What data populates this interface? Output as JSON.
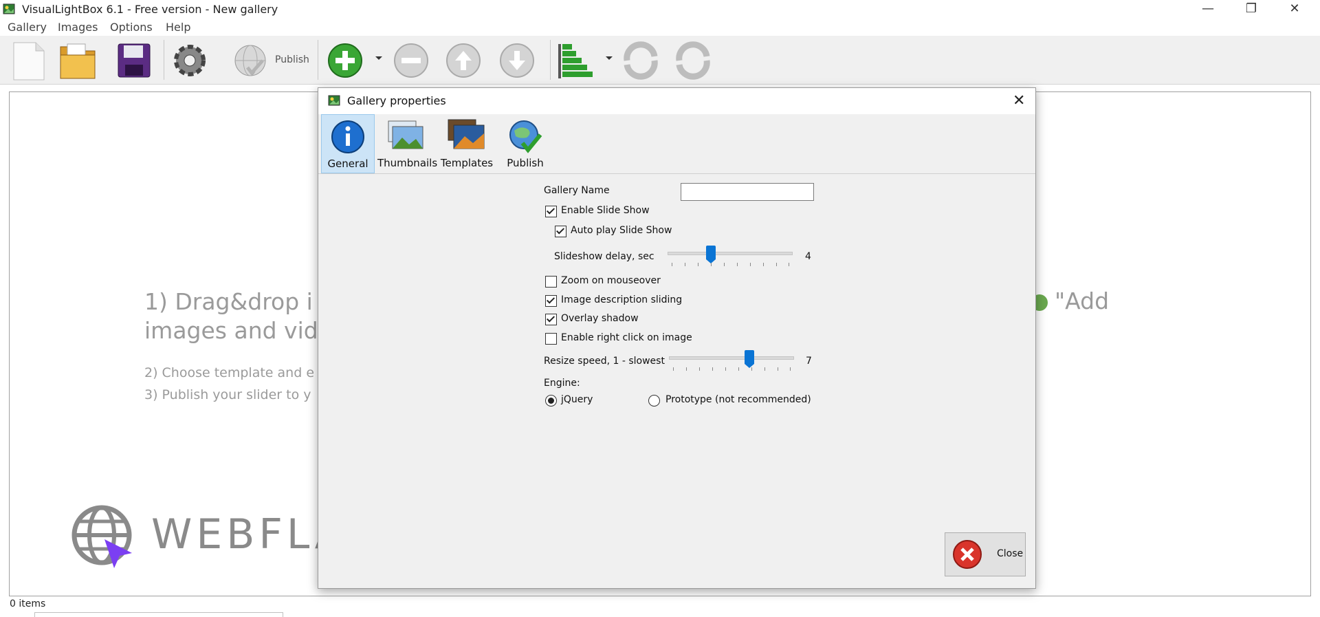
{
  "window": {
    "title": "VisualLightBox 6.1 - Free version -  New gallery",
    "controls": [
      "minimize-icon",
      "restore-icon",
      "close-icon"
    ]
  },
  "menu": {
    "items": [
      "Gallery",
      "Images",
      "Options",
      "Help"
    ]
  },
  "toolbar": {
    "publish_label": "Publish"
  },
  "canvas": {
    "instruction1_line1": "1) Drag&drop i",
    "instruction1_line2": "images and vid",
    "instruction1_tail": "\"Add",
    "instruction2": "2) Choose template and e",
    "instruction3": "3) Publish your slider to y"
  },
  "watermark": {
    "text": "WEBFLAT.ir"
  },
  "status": {
    "items": "0 items"
  },
  "dialog": {
    "title": "Gallery properties",
    "tabs": [
      {
        "label": "General",
        "icon": "info-icon",
        "active": true
      },
      {
        "label": "Thumbnails",
        "icon": "thumbnails-icon",
        "active": false
      },
      {
        "label": "Templates",
        "icon": "templates-icon",
        "active": false
      },
      {
        "label": "Publish",
        "icon": "globe-check-icon",
        "active": false
      }
    ],
    "general": {
      "gallery_name_label": "Gallery Name",
      "gallery_name_value": "",
      "enable_slideshow_label": "Enable Slide Show",
      "enable_slideshow_checked": true,
      "autoplay_label": "Auto play Slide Show",
      "autoplay_checked": true,
      "slideshow_delay_label": "Slideshow delay, sec",
      "slideshow_delay_value": "4",
      "zoom_label": "Zoom on mouseover",
      "zoom_checked": false,
      "desc_sliding_label": "Image description sliding",
      "desc_sliding_checked": true,
      "overlay_shadow_label": "Overlay shadow",
      "overlay_shadow_checked": true,
      "right_click_label": "Enable right click on image",
      "right_click_checked": false,
      "resize_speed_label": "Resize speed, 1 - slowest",
      "resize_speed_value": "7",
      "engine_label": "Engine:",
      "engine_options": [
        "jQuery",
        "Prototype (not recommended)"
      ],
      "engine_selected": "jQuery"
    },
    "close_label": "Close"
  },
  "colors": {
    "accent": "#0a74d4",
    "tab_active_bg": "#cce4f7",
    "close_red": "#d9342b"
  }
}
